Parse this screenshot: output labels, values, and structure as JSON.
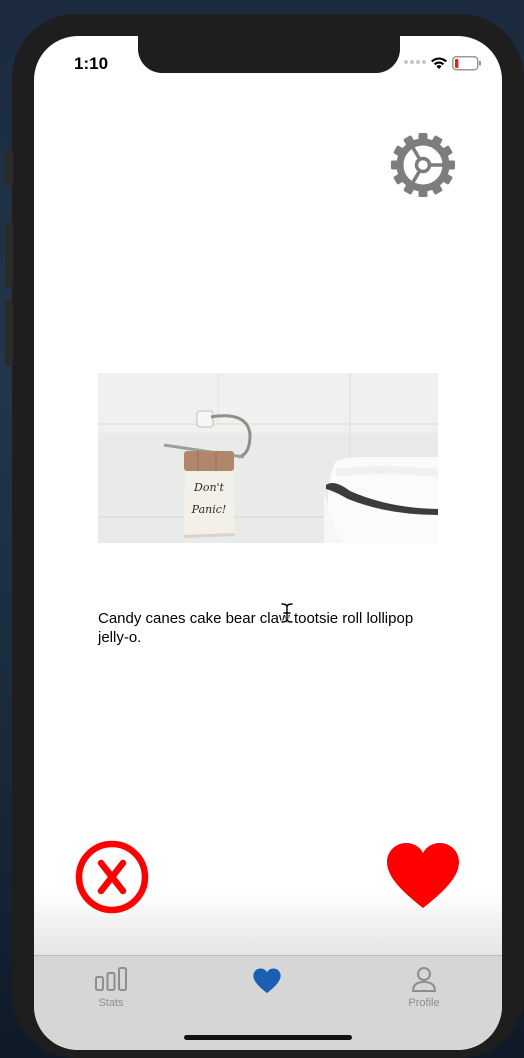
{
  "status_bar": {
    "time": "1:10",
    "battery_color": "#e0261c"
  },
  "settings": {
    "icon": "gear-icon",
    "color": "#7d7d80"
  },
  "card": {
    "image": {
      "subject": "toilet-paper-roll",
      "note_text": "Don't Panic!"
    },
    "caption": "Candy canes cake bear claw tootsie roll lollipop jelly-o."
  },
  "actions": {
    "reject_icon": "x-circle-icon",
    "like_icon": "heart-icon",
    "accent_red": "#ff0000"
  },
  "tabbar": {
    "active_color": "#1a5fb4",
    "inactive_color": "#8e8e8e",
    "tabs": [
      {
        "label": "Stats",
        "icon": "bar-chart-icon",
        "active": false
      },
      {
        "label": "",
        "icon": "heart-icon",
        "active": true
      },
      {
        "label": "Profile",
        "icon": "person-icon",
        "active": false
      }
    ]
  }
}
